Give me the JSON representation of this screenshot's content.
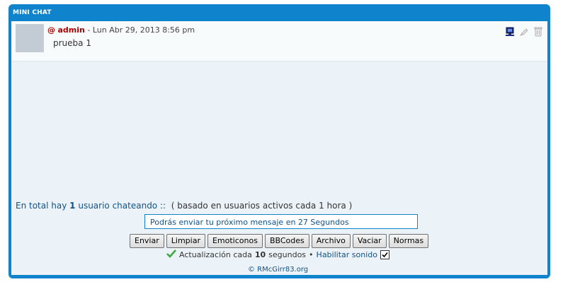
{
  "panel": {
    "title": "MINI CHAT"
  },
  "message": {
    "at": "@",
    "user": "admin",
    "meta": "- Lun Abr 29, 2013 8:56 pm",
    "text": "prueba 1",
    "icons": [
      "ip-icon",
      "edit-icon",
      "delete-icon"
    ]
  },
  "users": {
    "prefix": "En total hay",
    "count": "1",
    "suffix": "usuario chateando",
    "sep": "::",
    "note": "( basado en usuarios activos cada 1 hora )"
  },
  "input": {
    "value": "Podrás enviar tu próximo mensaje en 27 Segundos"
  },
  "buttons": [
    "Enviar",
    "Limpiar",
    "Emoticonos",
    "BBCodes",
    "Archivo",
    "Vaciar",
    "Normas"
  ],
  "status": {
    "label": "Actualización cada",
    "seconds": "10",
    "unit": "segundos",
    "bullet": "•",
    "sound": "Habilitar sonido",
    "sound_checked": true
  },
  "credit": "© RMcGirr83.org",
  "colors": {
    "panel": "#0f84cd",
    "background": "#ecf3f8",
    "username": "#aa0000",
    "link": "#105289"
  }
}
